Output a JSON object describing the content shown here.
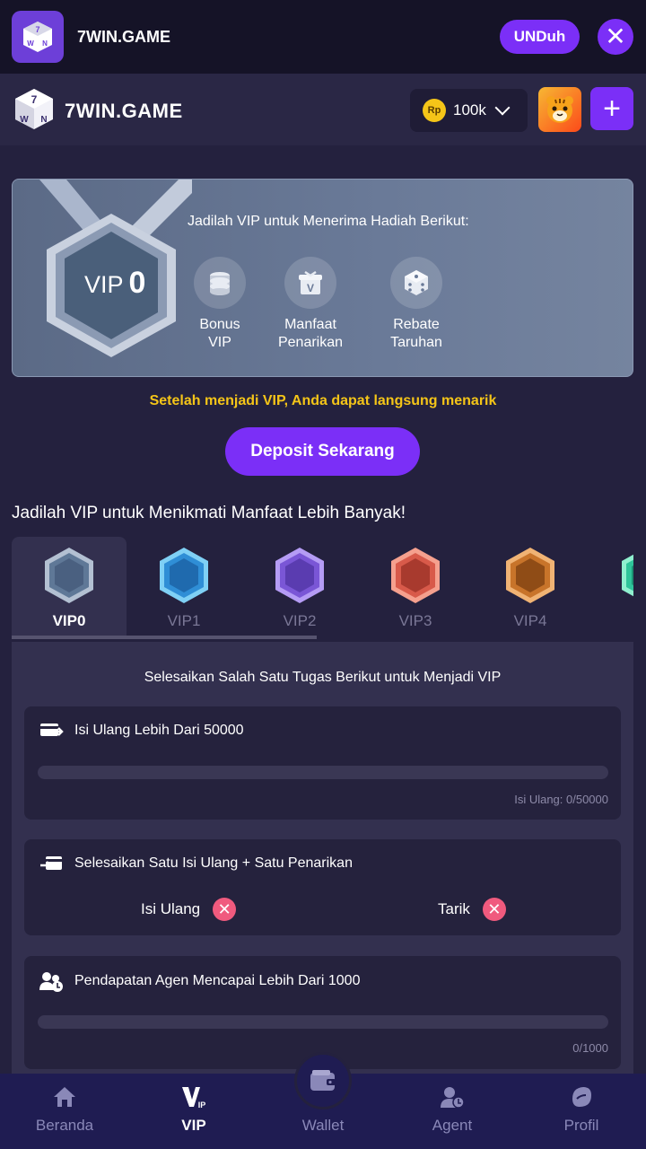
{
  "download_bar": {
    "title": "7WIN.GAME",
    "download_label": "UNDuh",
    "close_symbol": "✕"
  },
  "header": {
    "logo_text": "7WIN.GAME",
    "currency_symbol": "Rp",
    "balance": "100k",
    "add_symbol": "+"
  },
  "vip_card": {
    "badge_level": "VIP",
    "badge_number": "0",
    "title": "Jadilah VIP untuk Menerima Hadiah Berikut:",
    "perks": [
      {
        "icon": "coin-stack-icon",
        "label_line1": "Bonus",
        "label_line2": "VIP"
      },
      {
        "icon": "gift-v-icon",
        "label_line1": "Manfaat",
        "label_line2": "Penarikan"
      },
      {
        "icon": "dice-icon",
        "label_line1": "Rebate",
        "label_line2": "Taruhan"
      }
    ]
  },
  "note": "Setelah menjadi VIP, Anda dapat langsung menarik",
  "deposit_label": "Deposit Sekarang",
  "section_title": "Jadilah VIP untuk Menikmati Manfaat Lebih Banyak!",
  "tabs": [
    {
      "label": "VIP0",
      "color": "#5f7897",
      "active": true
    },
    {
      "label": "VIP1",
      "color": "#2f8ed6"
    },
    {
      "label": "VIP2",
      "color": "#7a56d6"
    },
    {
      "label": "VIP3",
      "color": "#d85a4a"
    },
    {
      "label": "VIP4",
      "color": "#c8742a"
    },
    {
      "label": "V",
      "color": "#2fc49a"
    }
  ],
  "tasks_panel": {
    "title": "Selesaikan Salah Satu Tugas Berikut untuk Menjadi VIP",
    "task1": {
      "label": "Isi Ulang Lebih Dari 50000",
      "progress_text": "Isi Ulang: 0/50000",
      "progress": 0
    },
    "task2": {
      "label": "Selesaikan Satu Isi Ulang + Satu Penarikan",
      "req1": "Isi Ulang",
      "req2": "Tarik",
      "status_symbol": "✕"
    },
    "task3": {
      "label": "Pendapatan Agen Mencapai Lebih Dari 1000",
      "progress_text": "0/1000",
      "progress": 0
    }
  },
  "bottom_nav": [
    {
      "label": "Beranda",
      "icon": "home-icon"
    },
    {
      "label": "VIP",
      "icon": "vip-icon",
      "active": true
    },
    {
      "label": "Wallet",
      "icon": "wallet-icon"
    },
    {
      "label": "Agent",
      "icon": "agent-icon"
    },
    {
      "label": "Profil",
      "icon": "profile-icon"
    }
  ],
  "colors": {
    "accent": "#7b2ff7",
    "background": "#24213e",
    "note": "#f5c518",
    "error": "#f05a7e"
  }
}
